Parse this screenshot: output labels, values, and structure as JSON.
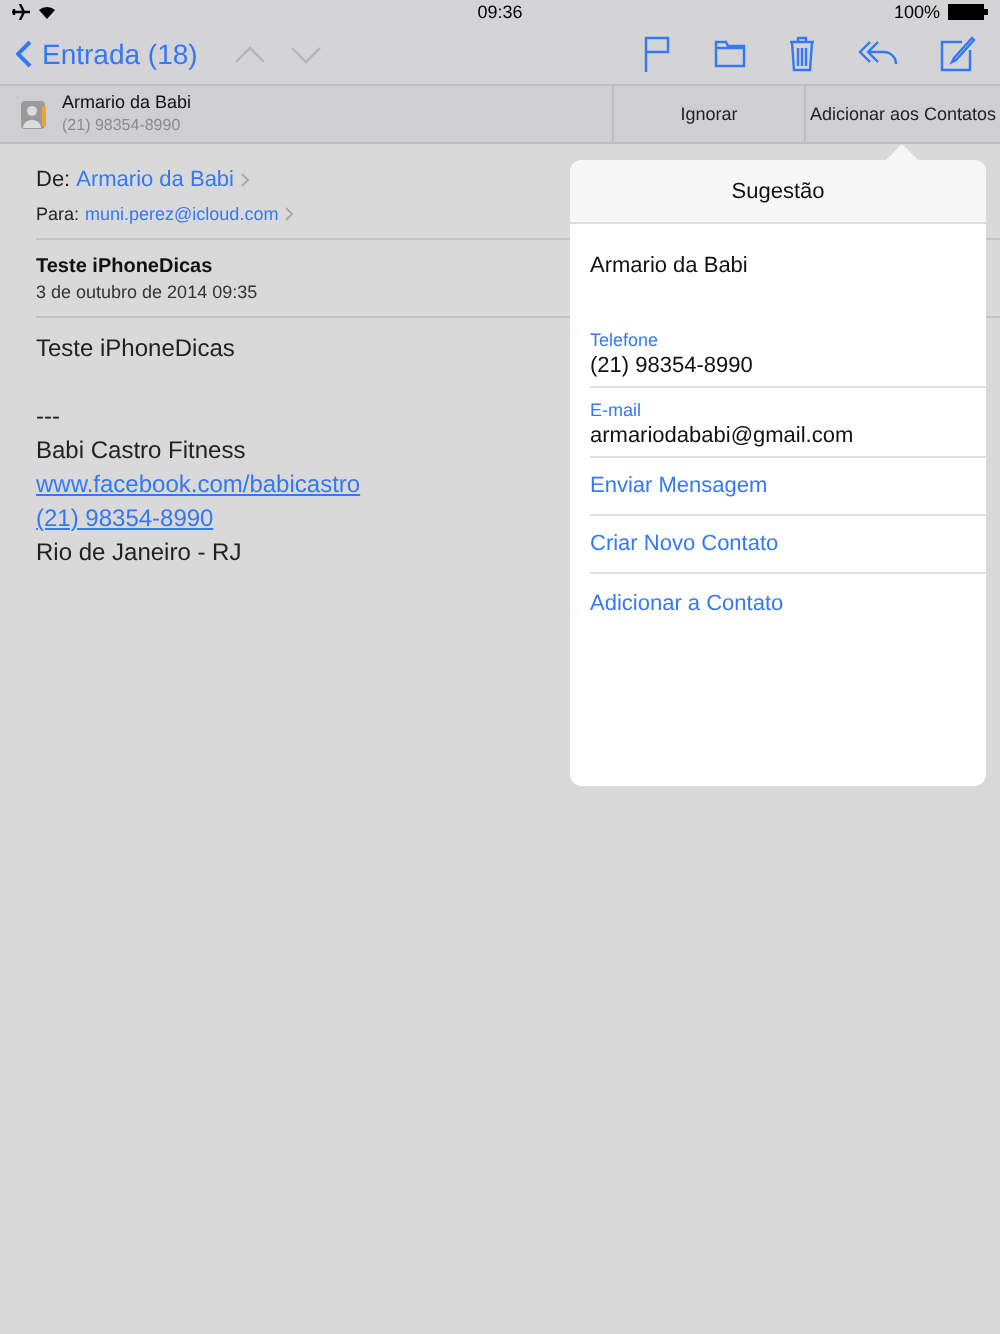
{
  "status_bar": {
    "time": "09:36",
    "battery": "100%"
  },
  "nav": {
    "back": "Entrada (18)"
  },
  "suggestion_bar": {
    "name": "Armario da Babi",
    "phone": "(21) 98354-8990",
    "actions": [
      "Ignorar",
      "Adicionar aos Contatos"
    ]
  },
  "message": {
    "from_label": "De:",
    "from": "Armario da Babi",
    "to_label": "Para:",
    "to": "muni.perez@icloud.com",
    "subject": "Teste iPhoneDicas",
    "date": "3 de outubro de 2014 09:35",
    "body": [
      {
        "kind": "text",
        "text": "Teste iPhoneDicas"
      },
      {
        "kind": "blank"
      },
      {
        "kind": "text",
        "text": "---"
      },
      {
        "kind": "text",
        "text": "Babi Castro Fitness"
      },
      {
        "kind": "link",
        "text": "www.facebook.com/babicastro"
      },
      {
        "kind": "link",
        "text": "(21) 98354-8990"
      },
      {
        "kind": "text",
        "text": "Rio de Janeiro - RJ"
      }
    ]
  },
  "popover": {
    "title": "Sugestão",
    "name": "Armario da Babi",
    "fields": [
      {
        "label": "Telefone",
        "value": "(21) 98354-8990"
      },
      {
        "label": "E-mail",
        "value": "armariodababi@gmail.com"
      }
    ],
    "actions": [
      "Enviar Mensagem",
      "Criar Novo Contato",
      "Adicionar a Contato"
    ]
  }
}
